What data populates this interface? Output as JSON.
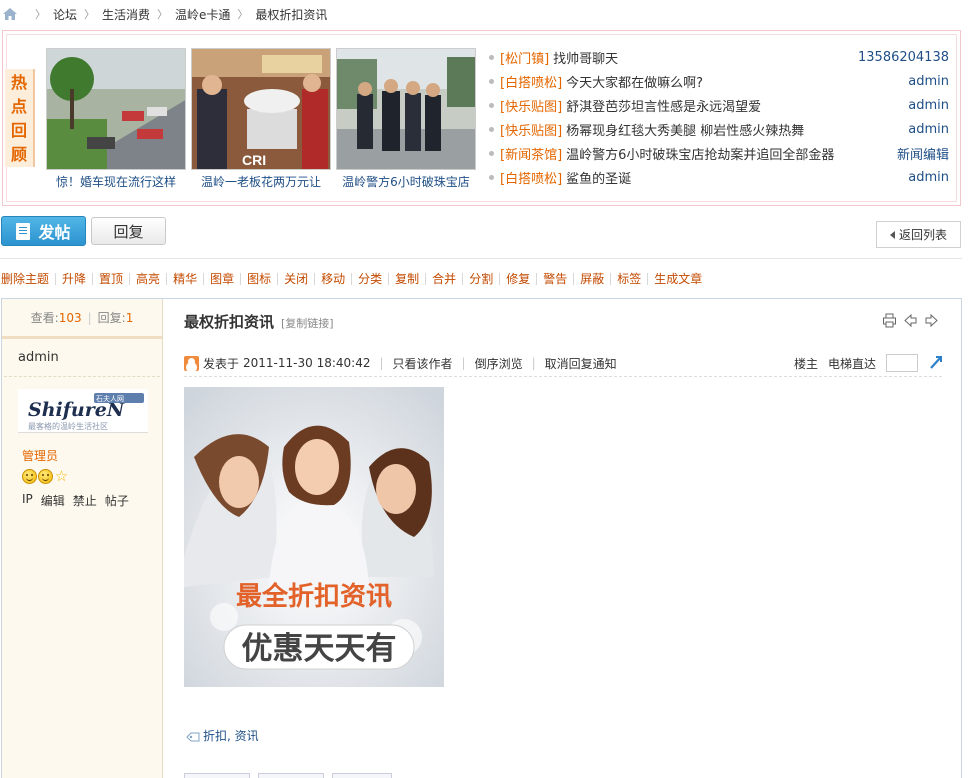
{
  "breadcrumb": {
    "items": [
      "论坛",
      "生活消费",
      "温岭e卡通",
      "最权折扣资讯"
    ]
  },
  "hot_review": {
    "title": "热点回顾",
    "thumbnails": [
      {
        "caption": "惊！婚车现在流行这样"
      },
      {
        "caption": "温岭一老板花两万元让"
      },
      {
        "caption": "温岭警方6小时破珠宝店"
      }
    ],
    "list": [
      {
        "category": "[松门镇]",
        "title": "找帅哥聊天",
        "author": "13586204138"
      },
      {
        "category": "[白搭喷松]",
        "title": "今天大家都在做嘛么啊?",
        "author": "admin"
      },
      {
        "category": "[快乐贴图]",
        "title": "舒淇登芭莎坦言性感是永远渴望爱",
        "author": "admin"
      },
      {
        "category": "[快乐贴图]",
        "title": "杨幂现身红毯大秀美腿 柳岩性感火辣热舞",
        "author": "admin"
      },
      {
        "category": "[新闻茶馆]",
        "title": "温岭警方6小时破珠宝店抢劫案并追回全部金器",
        "author": "新闻编辑"
      },
      {
        "category": "[白搭喷松]",
        "title": "鲨鱼的圣诞",
        "author": "admin"
      }
    ]
  },
  "actions": {
    "post_label": "发帖",
    "reply_label": "回复",
    "back_label": "返回列表"
  },
  "mod_tools": [
    "删除主题",
    "升降",
    "置顶",
    "高亮",
    "精华",
    "图章",
    "图标",
    "关闭",
    "移动",
    "分类",
    "复制",
    "合并",
    "分割",
    "修复",
    "警告",
    "屏蔽",
    "标签",
    "生成文章"
  ],
  "side": {
    "views_label": "查看:",
    "views": "103",
    "replies_label": "回复:",
    "replies": "1",
    "username": "admin",
    "logo_text": "ShifureN",
    "logo_badge": "石夫人网",
    "logo_sub": "最客格的温岭生活社区",
    "role": "管理员",
    "user_actions": [
      "IP",
      "编辑",
      "禁止",
      "帖子"
    ]
  },
  "post": {
    "title": "最权折扣资讯",
    "copy_link": "[复制链接]",
    "posted_label": "发表于",
    "posted_time": "2011-11-30 18:40:42",
    "only_author": "只看该作者",
    "reverse_browse": "倒序浏览",
    "cancel_notify": "取消回复通知",
    "floor": "楼主",
    "elevator": "电梯直达",
    "poster_headline": "最全折扣资讯",
    "poster_sub": "优惠天天有",
    "tags": "折扣, 资讯"
  },
  "colors": {
    "accent_orange": "#e46600",
    "link_blue": "#1f4f86",
    "post_button": "#2c93cf",
    "side_bg": "#fdf9ee"
  }
}
